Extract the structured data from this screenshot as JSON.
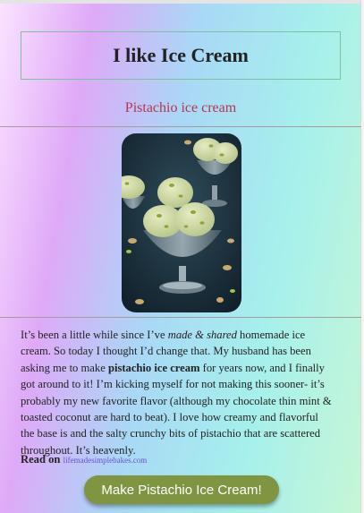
{
  "header": {
    "title": "I like Ice Cream"
  },
  "recipe": {
    "subtitle": "Pistachio ice cream",
    "photo_alt": "pistachio ice cream in glass cups",
    "paragraph": {
      "p1": "It’s been a little while since I’ve ",
      "em1": "made & shared",
      "p2": " homemade ice cream. So today I thought I’d change that. My husband has been asking me to make ",
      "strong1": "pistachio ice cream",
      "p3": " for years now, and I finally got around to it! I’m kicking myself for not making this sooner- it’s probably my new favorite flavor (although my chocolate thin mint & toasted coconut are hard to beat). I love how creamy and flavorful the base is and the salty crunchy bits of pistachio that are scattered throughout. It’s heavenly."
    },
    "read_on_label": "Read on",
    "read_on_link": "lifemadesimplebakes.com",
    "cta_label": "Make Pistachio Ice Cream!"
  },
  "colors": {
    "subtitle": "#b5374e",
    "title_border": "#7cc39b",
    "cta_background": "#7f9542",
    "link": "#6a4fd6"
  }
}
